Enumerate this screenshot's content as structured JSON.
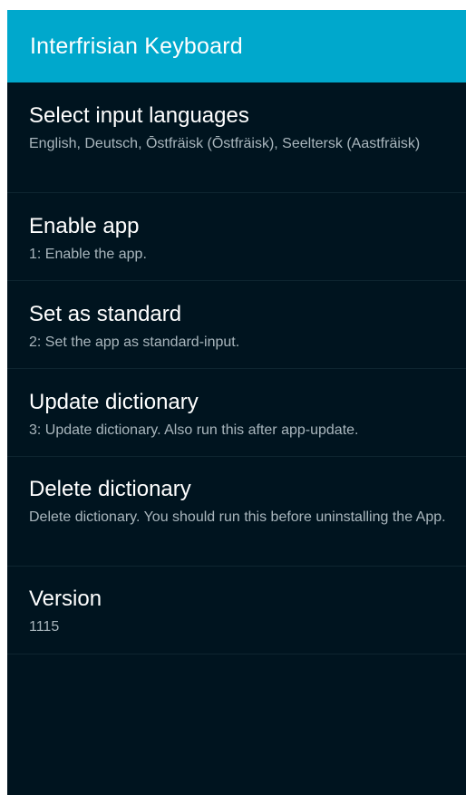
{
  "app_bar": {
    "title": "Interfrisian Keyboard",
    "background_color": "#00a8cc"
  },
  "preferences": [
    {
      "title": "Select input languages",
      "summary": "English, Deutsch, Ōstfräisk (Ōstfräisk), Seeltersk (Aastfräisk)"
    },
    {
      "title": "Enable app",
      "summary": "1: Enable the app."
    },
    {
      "title": "Set as standard",
      "summary": "2: Set the app as standard-input."
    },
    {
      "title": "Update dictionary",
      "summary": "3: Update dictionary. Also run this after app-update."
    },
    {
      "title": "Delete dictionary",
      "summary": "Delete dictionary. You should run this before uninstalling the App."
    },
    {
      "title": "Version",
      "summary": "1115"
    }
  ],
  "colors": {
    "screen_background": "#00141f",
    "divider": "#0e2530",
    "title_text": "#ffffff",
    "summary_text": "#a9b6bd"
  }
}
